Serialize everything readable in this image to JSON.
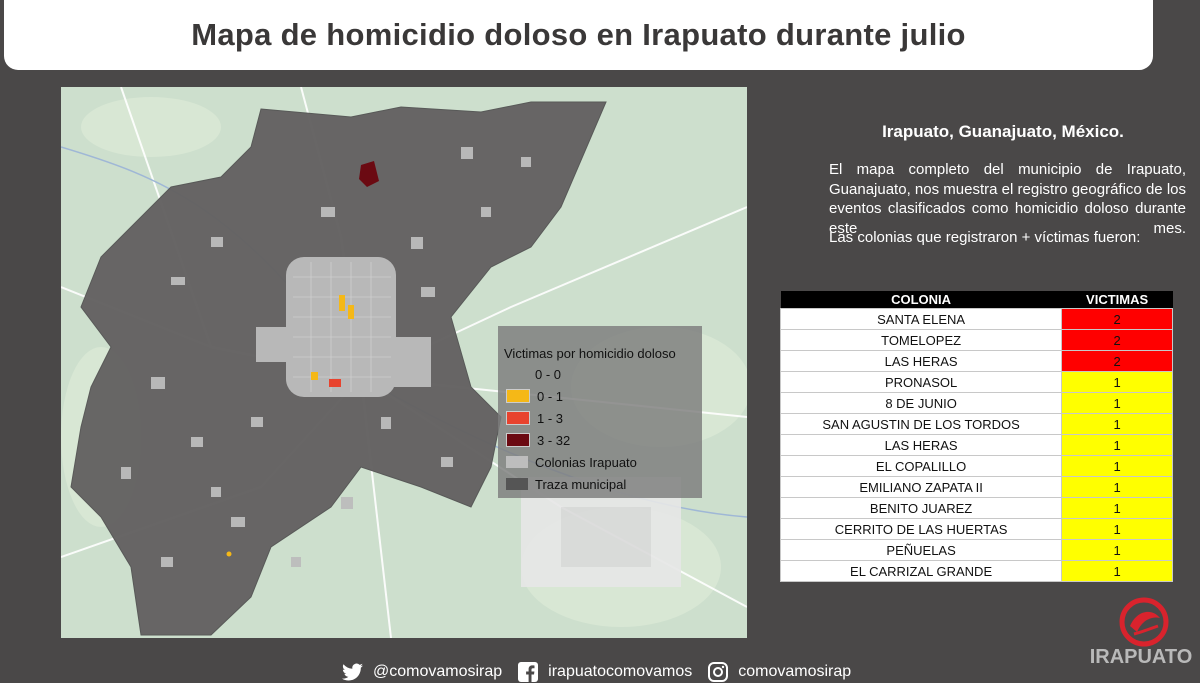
{
  "title": "Mapa de homicidio doloso en Irapuato durante julio",
  "location": "Irapuato, Guanajuato, México.",
  "description": "El mapa completo del municipio de Irapuato, Guanajuato, nos muestra el registro geográfico de los eventos clasificados como homicidio doloso durante este mes.",
  "colonias_intro": "Las colonias que registraron + víctimas fueron:",
  "legend": {
    "title": "Victimas por homicidio doloso",
    "items": [
      {
        "label": "0 - 0",
        "color": "#7d7d7d"
      },
      {
        "label": "0 - 1",
        "color": "#f5b817"
      },
      {
        "label": "1 - 3",
        "color": "#e8432e"
      },
      {
        "label": "3 - 32",
        "color": "#6b0a12"
      },
      {
        "label": "Colonias Irapuato",
        "color": "#bdbdbd"
      },
      {
        "label": "Traza municipal",
        "color": "#555555"
      }
    ]
  },
  "table": {
    "headers": [
      "COLONIA",
      "VICTIMAS"
    ],
    "rows": [
      {
        "colonia": "SANTA ELENA",
        "victimas": "2",
        "color": "#ff0000"
      },
      {
        "colonia": "TOMELOPEZ",
        "victimas": "2",
        "color": "#ff0000"
      },
      {
        "colonia": "LAS HERAS",
        "victimas": "2",
        "color": "#ff0000"
      },
      {
        "colonia": "PRONASOL",
        "victimas": "1",
        "color": "#ffff00"
      },
      {
        "colonia": "8 DE JUNIO",
        "victimas": "1",
        "color": "#ffff00"
      },
      {
        "colonia": "SAN AGUSTIN DE LOS TORDOS",
        "victimas": "1",
        "color": "#ffff00"
      },
      {
        "colonia": "LAS HERAS",
        "victimas": "1",
        "color": "#ffff00"
      },
      {
        "colonia": "EL COPALILLO",
        "victimas": "1",
        "color": "#ffff00"
      },
      {
        "colonia": "EMILIANO ZAPATA II",
        "victimas": "1",
        "color": "#ffff00"
      },
      {
        "colonia": "BENITO JUAREZ",
        "victimas": "1",
        "color": "#ffff00"
      },
      {
        "colonia": "CERRITO DE LAS HUERTAS",
        "victimas": "1",
        "color": "#ffff00"
      },
      {
        "colonia": "PEÑUELAS",
        "victimas": "1",
        "color": "#ffff00"
      },
      {
        "colonia": "EL CARRIZAL GRANDE",
        "victimas": "1",
        "color": "#ffff00"
      }
    ]
  },
  "footer": {
    "twitter": "@comovamosirap",
    "facebook": "irapuatocomovamos",
    "instagram": "comovamosirap"
  },
  "logo": {
    "text": "IRAPUATO",
    "accent": "#d9232d"
  },
  "icons": {
    "twitter": "twitter-icon",
    "facebook": "facebook-icon",
    "instagram": "instagram-icon"
  }
}
